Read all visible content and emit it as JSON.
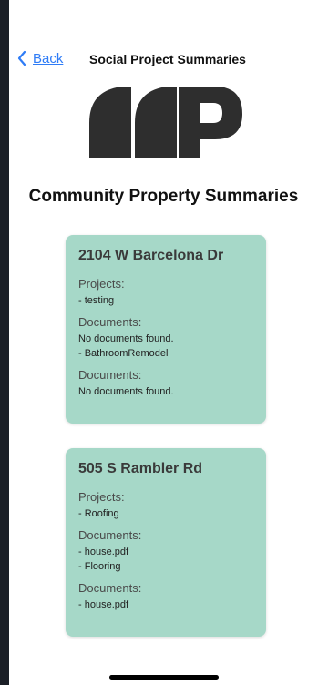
{
  "nav": {
    "back_label": "Back",
    "title": "Social Project Summaries"
  },
  "logo": {
    "letter": "P",
    "color": "#2e2e2e"
  },
  "heading": "Community Property Summaries",
  "properties": [
    {
      "address": "2104 W Barcelona Dr",
      "projects_label": "Projects:",
      "project_items": [
        "- testing"
      ],
      "documents_label_1": "Documents:",
      "document_items_1": [
        "No documents found.",
        "- BathroomRemodel"
      ],
      "documents_label_2": "Documents:",
      "document_items_2": [
        "No documents found."
      ]
    },
    {
      "address": "505 S Rambler Rd",
      "projects_label": "Projects:",
      "project_items": [
        "- Roofing"
      ],
      "documents_label_1": "Documents:",
      "document_items_1": [
        "- house.pdf",
        "- Flooring"
      ],
      "documents_label_2": "Documents:",
      "document_items_2": [
        "- house.pdf"
      ]
    }
  ],
  "colors": {
    "card_background": "#a6d8c8",
    "link": "#2f7cf6"
  }
}
